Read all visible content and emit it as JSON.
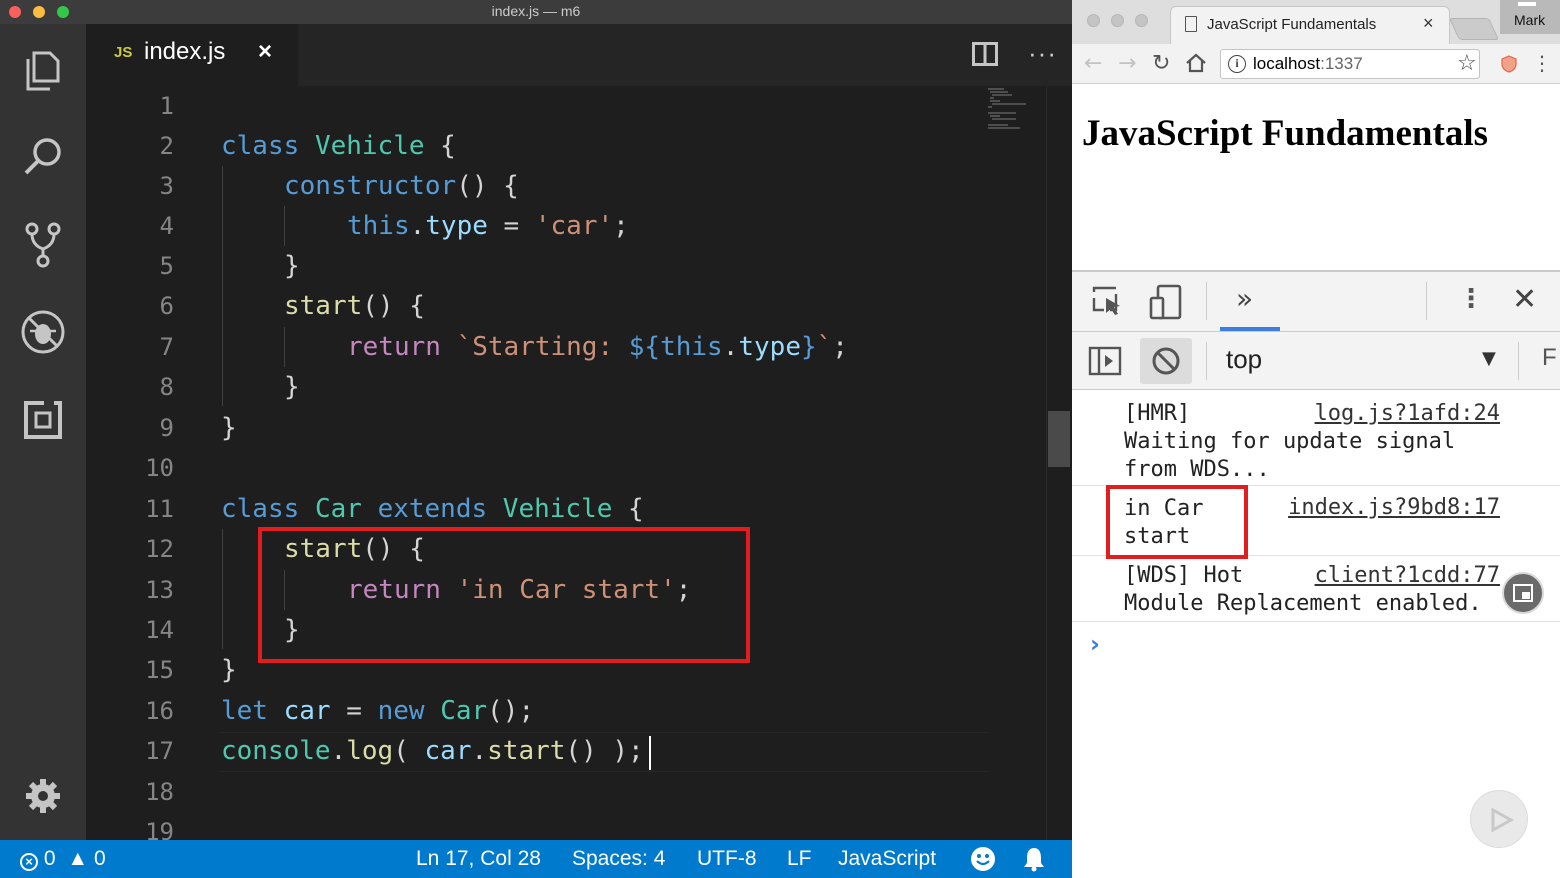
{
  "vscode": {
    "window_title": "index.js — m6",
    "tab": {
      "badge": "JS",
      "label": "index.js",
      "close": "×"
    },
    "more_actions": "···",
    "code_lines": [
      {
        "num": "1"
      },
      {
        "num": "2"
      },
      {
        "num": "3"
      },
      {
        "num": "4"
      },
      {
        "num": "5"
      },
      {
        "num": "6"
      },
      {
        "num": "7"
      },
      {
        "num": "8"
      },
      {
        "num": "9"
      },
      {
        "num": "10"
      },
      {
        "num": "11"
      },
      {
        "num": "12"
      },
      {
        "num": "13"
      },
      {
        "num": "14"
      },
      {
        "num": "15"
      },
      {
        "num": "16"
      },
      {
        "num": "17"
      },
      {
        "num": "18"
      },
      {
        "num": "19"
      }
    ],
    "code": {
      "l2": {
        "kw": "class",
        "name": "Vehicle",
        "brace": "{"
      },
      "l3": {
        "fn": "constructor",
        "rest": "() {"
      },
      "l4": {
        "kw": "this",
        "dot": ".",
        "prop": "type",
        "op": " = ",
        "str": "'car'",
        "semi": ";"
      },
      "l5": {
        "brace": "}"
      },
      "l6": {
        "fn": "start",
        "rest": "() {"
      },
      "l7": {
        "kw": "return",
        "str1": "`Starting: ",
        "tpl_open": "${",
        "tpl_this": "this",
        "dot": ".",
        "tpl_prop": "type",
        "tpl_close": "}",
        "str2": "`",
        "semi": ";"
      },
      "l8": {
        "brace": "}"
      },
      "l9": {
        "brace": "}"
      },
      "l11": {
        "kw": "class",
        "name": "Car",
        "kw2": "extends",
        "base": "Vehicle",
        "brace": "{"
      },
      "l12": {
        "fn": "start",
        "rest": "() {"
      },
      "l13": {
        "kw": "return",
        "str": "'in Car start'",
        "semi": ";"
      },
      "l14": {
        "brace": "}"
      },
      "l15": {
        "brace": "}"
      },
      "l16": {
        "kw": "let",
        "var": "car",
        "op": " = ",
        "kw2": "new",
        "cls": "Car",
        "rest": "();"
      },
      "l17": {
        "obj": "console",
        "dot": ".",
        "fn": "log",
        "p1": "( ",
        "var": "car",
        "dot2": ".",
        "fn2": "start",
        "p2": "() );"
      }
    },
    "status": {
      "errors": "0",
      "warnings": "0",
      "position": "Ln 17, Col 28",
      "spaces": "Spaces: 4",
      "encoding": "UTF-8",
      "eol": "LF",
      "language": "JavaScript"
    }
  },
  "chrome": {
    "tab_title": "JavaScript Fundamentals",
    "tab_close": "×",
    "profile_name": "Mark",
    "url_host": "localhost",
    "url_port": ":1337",
    "page_heading": "JavaScript Fundamentals",
    "devtools": {
      "more_tabs": "»",
      "context": "top",
      "filter_letter": "F",
      "messages": [
        {
          "text": "[HMR]\nWaiting for update signal\nfrom WDS...",
          "source": "log.js?1afd:24"
        },
        {
          "text": "in Car\nstart",
          "source": "index.js?9bd8:17"
        },
        {
          "text": "[WDS] Hot\nModule Replacement enabled.",
          "source": "client?1cdd:77"
        }
      ],
      "prompt": "›"
    }
  },
  "colors": {
    "vscode_status": "#007acc",
    "highlight_box": "#e21d1d",
    "keyword": "#569cd6",
    "class_name": "#4ec9b0",
    "function": "#dcdcaa",
    "string": "#ce9178",
    "control": "#c586c0",
    "property": "#9cdcfe"
  }
}
